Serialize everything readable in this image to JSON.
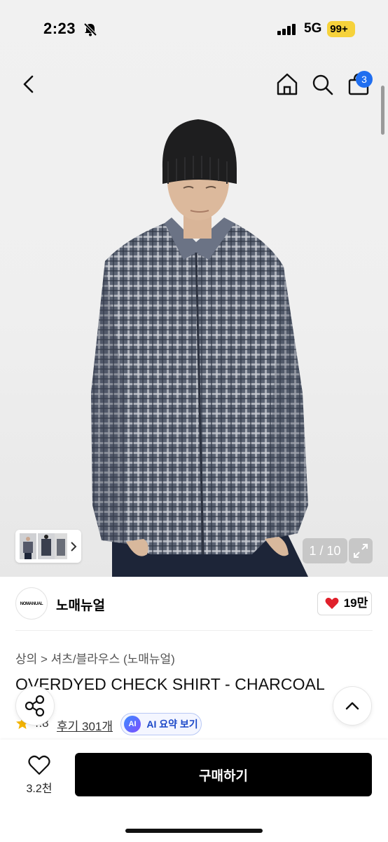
{
  "status_bar": {
    "time": "2:23",
    "network": "5G",
    "battery": "99+"
  },
  "nav": {
    "cart_count": "3"
  },
  "gallery": {
    "counter": "1 / 10"
  },
  "brand": {
    "logo_text": "NOMANUAL",
    "name": "노매뉴얼",
    "likes": "19만"
  },
  "product": {
    "breadcrumb": "상의 > 셔츠/블라우스 (노매뉴얼)",
    "title": "OVERDYED CHECK SHIRT - CHARCOAL",
    "rating": "4.8",
    "reviews": "후기 301개",
    "ai_summary": "AI 요약 보기",
    "ai_badge": "AI"
  },
  "bottom_bar": {
    "wish_count": "3.2천",
    "buy_label": "구매하기"
  },
  "colors": {
    "accent": "#1f6ef0",
    "like": "#e0202b",
    "star": "#f4b400",
    "buy_bg": "#000000"
  },
  "icons": [
    "back-icon",
    "home-icon",
    "search-icon",
    "cart-icon",
    "chevron-right-icon",
    "expand-icon",
    "heart-icon",
    "star-icon",
    "share-icon",
    "chevron-up-icon",
    "bell-slash-icon",
    "signal-icon"
  ]
}
